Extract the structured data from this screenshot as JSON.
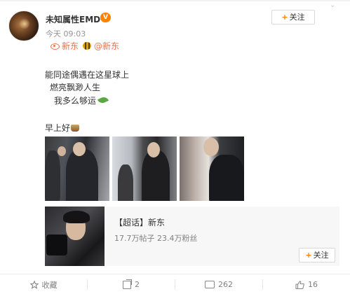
{
  "post": {
    "username": "未知属性EMD",
    "vip_badge": "V",
    "time": "今天 09:03",
    "follow_label": "关注",
    "tag": {
      "super_topic": "新东",
      "mention": "@新东"
    },
    "text_lines": [
      "能同途偶遇在这星球上",
      "燃亮飘渺人生",
      "我多么够运",
      "早上好"
    ],
    "photos": [
      "photo-1",
      "photo-2",
      "photo-3"
    ]
  },
  "topic_card": {
    "title": "【超话】新东",
    "stats": "17.7万帖子 23.4万粉丝",
    "follow_label": "关注"
  },
  "actions": {
    "favorite_label": "收藏",
    "share_count": "2",
    "comment_count": "262",
    "like_count": "16"
  },
  "colors": {
    "accent_orange": "#ff8200",
    "tag_color": "#eb7350",
    "muted_text": "#939393"
  }
}
